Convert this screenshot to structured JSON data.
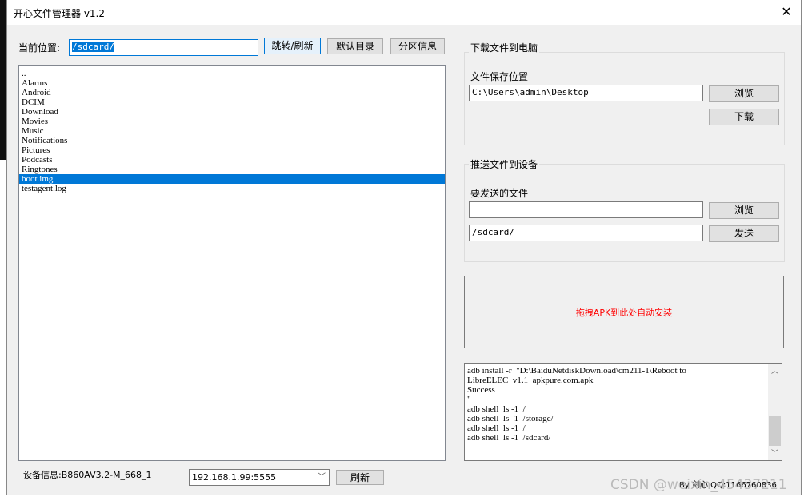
{
  "window": {
    "title": "开心文件管理器  v1.2",
    "close_icon": "close-icon"
  },
  "location": {
    "label": "当前位置:",
    "value": "/sdcard/",
    "go_button": "跳转/刷新",
    "default_button": "默认目录",
    "partition_button": "分区信息"
  },
  "files": {
    "items": [
      "..",
      "Alarms",
      "Android",
      "DCIM",
      "Download",
      "Movies",
      "Music",
      "Notifications",
      "Pictures",
      "Podcasts",
      "Ringtones",
      "boot.img",
      "testagent.log"
    ],
    "selected": "boot.img"
  },
  "download": {
    "group_title": "下载文件到电脑",
    "save_label": "文件保存位置",
    "save_path": "C:\\Users\\admin\\Desktop",
    "browse_button": "浏览",
    "download_button": "下载"
  },
  "push": {
    "group_title": "推送文件到设备",
    "file_label": "要发送的文件",
    "file_value": "",
    "target_path": "/sdcard/",
    "browse_button": "浏览",
    "send_button": "发送"
  },
  "dropzone": {
    "text": "拖拽APK到此处自动安装",
    "color": "#ff0000"
  },
  "log": {
    "text": "adb install -r  \"D:\\BaiduNetdiskDownload\\cm211-1\\Reboot to LibreELEC_v1.1_apkpure.com.apk\nSuccess\n\"\nadb shell  ls -1  /\nadb shell  ls -1  /storage/\nadb shell  ls -1  /\nadb shell  ls -1  /sdcard/"
  },
  "device": {
    "label": "设备信息:B860AV3.2-M_668_1",
    "address": "192.168.1.99:5555",
    "refresh_button": "刷新"
  },
  "footer": {
    "credit": "By 剑心  QQ:1166760836",
    "watermark": "CSDN @weixin_45437211"
  }
}
